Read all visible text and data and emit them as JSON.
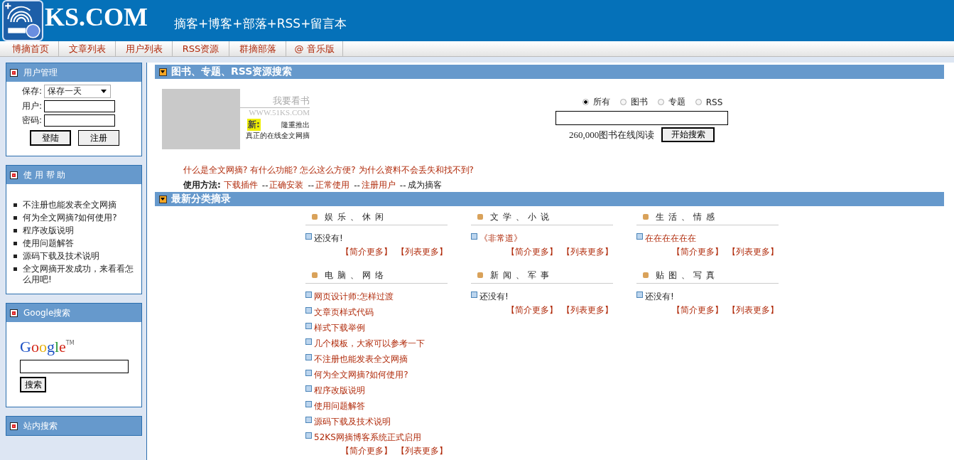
{
  "header": {
    "logo_text": "KS.COM",
    "tagline": "摘客+博客+部落+RSS+留言本"
  },
  "nav": [
    "博摘首页",
    "文章列表",
    "用户列表",
    "RSS资源",
    "群摘部落",
    "@ 音乐版"
  ],
  "login": {
    "title": "用户管理",
    "save_label": "保存:",
    "save_value": "保存一天",
    "user_label": "用户:",
    "password_label": "密码:",
    "buttons": [
      "登陆",
      "注册"
    ]
  },
  "help": {
    "title": "使 用 帮 助",
    "items": [
      "不注册也能发表全文网摘",
      "何为全文网摘?如何使用?",
      "程序改版说明",
      "使用问题解答",
      "源码下载及技术说明",
      "全文网摘开发成功，来看看怎么用吧!"
    ]
  },
  "google": {
    "title": "Google搜索",
    "logo": "Google",
    "trademark": "TM",
    "button": "搜索"
  },
  "site_search": {
    "title": "站内搜索"
  },
  "book_search": {
    "title": "图书、专题、RSS资源搜索",
    "promo_title": "我要看书",
    "promo_url": "WWW.51KS.COM",
    "new_badge": "新:",
    "promo_line1": "隆重推出",
    "promo_line2": "真正的在线全文网摘",
    "options": [
      {
        "label": "所有",
        "selected": true
      },
      {
        "label": "图书",
        "selected": false
      },
      {
        "label": "专题",
        "selected": false
      },
      {
        "label": "RSS",
        "selected": false
      }
    ],
    "count_text": "260,000图书在线阅读",
    "button": "开始搜索",
    "questions": "什么是全文网摘? 有什么功能? 怎么这么方便? 为什么资料不会丢失和找不到?",
    "usage_label": "使用方法:",
    "usage_steps": [
      {
        "text": "下载插件",
        "kind": "link"
      },
      {
        "prefix": "--",
        "text": "正确安装",
        "kind": "link"
      },
      {
        "prefix": "--",
        "text": "正常使用",
        "kind": "link"
      },
      {
        "prefix": "--",
        "text": "注册用户",
        "kind": "link"
      },
      {
        "prefix": "--",
        "text": "成为摘客",
        "kind": "plain"
      }
    ]
  },
  "categories": {
    "title": "最新分类摘录",
    "groups": [
      {
        "name": "娱 乐 、 休 闲",
        "more": [
          "【简介更多】",
          "【列表更多】"
        ],
        "items": [
          {
            "text": "还没有!",
            "kind": "empty"
          }
        ]
      },
      {
        "name": "文 学 、 小 说",
        "more": [
          "【简介更多】",
          "【列表更多】"
        ],
        "items": [
          {
            "text": "《非常道》",
            "kind": "link"
          }
        ]
      },
      {
        "name": "生 活 、 情 感",
        "more": [
          "【简介更多】",
          "【列表更多】"
        ],
        "items": [
          {
            "text": "在在在在在在",
            "kind": "link"
          }
        ]
      },
      {
        "name": "电 脑 、 网 络",
        "more": [
          "【简介更多】",
          "【列表更多】"
        ],
        "items": [
          {
            "text": "网页设计师:怎样过渡",
            "kind": "link"
          },
          {
            "text": "文章页样式代码",
            "kind": "link"
          },
          {
            "text": "样式下载举例",
            "kind": "link"
          },
          {
            "text": "几个模板，大家可以参考一下",
            "kind": "link"
          },
          {
            "text": "不注册也能发表全文网摘",
            "kind": "link"
          },
          {
            "text": "何为全文网摘?如何使用?",
            "kind": "link"
          },
          {
            "text": "程序改版说明",
            "kind": "link"
          },
          {
            "text": "使用问题解答",
            "kind": "link"
          },
          {
            "text": "源码下载及技术说明",
            "kind": "link"
          },
          {
            "text": "52KS网摘博客系统正式启用",
            "kind": "link"
          }
        ]
      },
      {
        "name": "新 闻 、 军 事",
        "more": [
          "【简介更多】",
          "【列表更多】"
        ],
        "items": [
          {
            "text": "还没有!",
            "kind": "empty"
          }
        ]
      },
      {
        "name": "贴 图 、 写 真",
        "more": [
          "【简介更多】",
          "【列表更多】"
        ],
        "items": [
          {
            "text": "还没有!",
            "kind": "empty"
          }
        ]
      }
    ]
  }
}
